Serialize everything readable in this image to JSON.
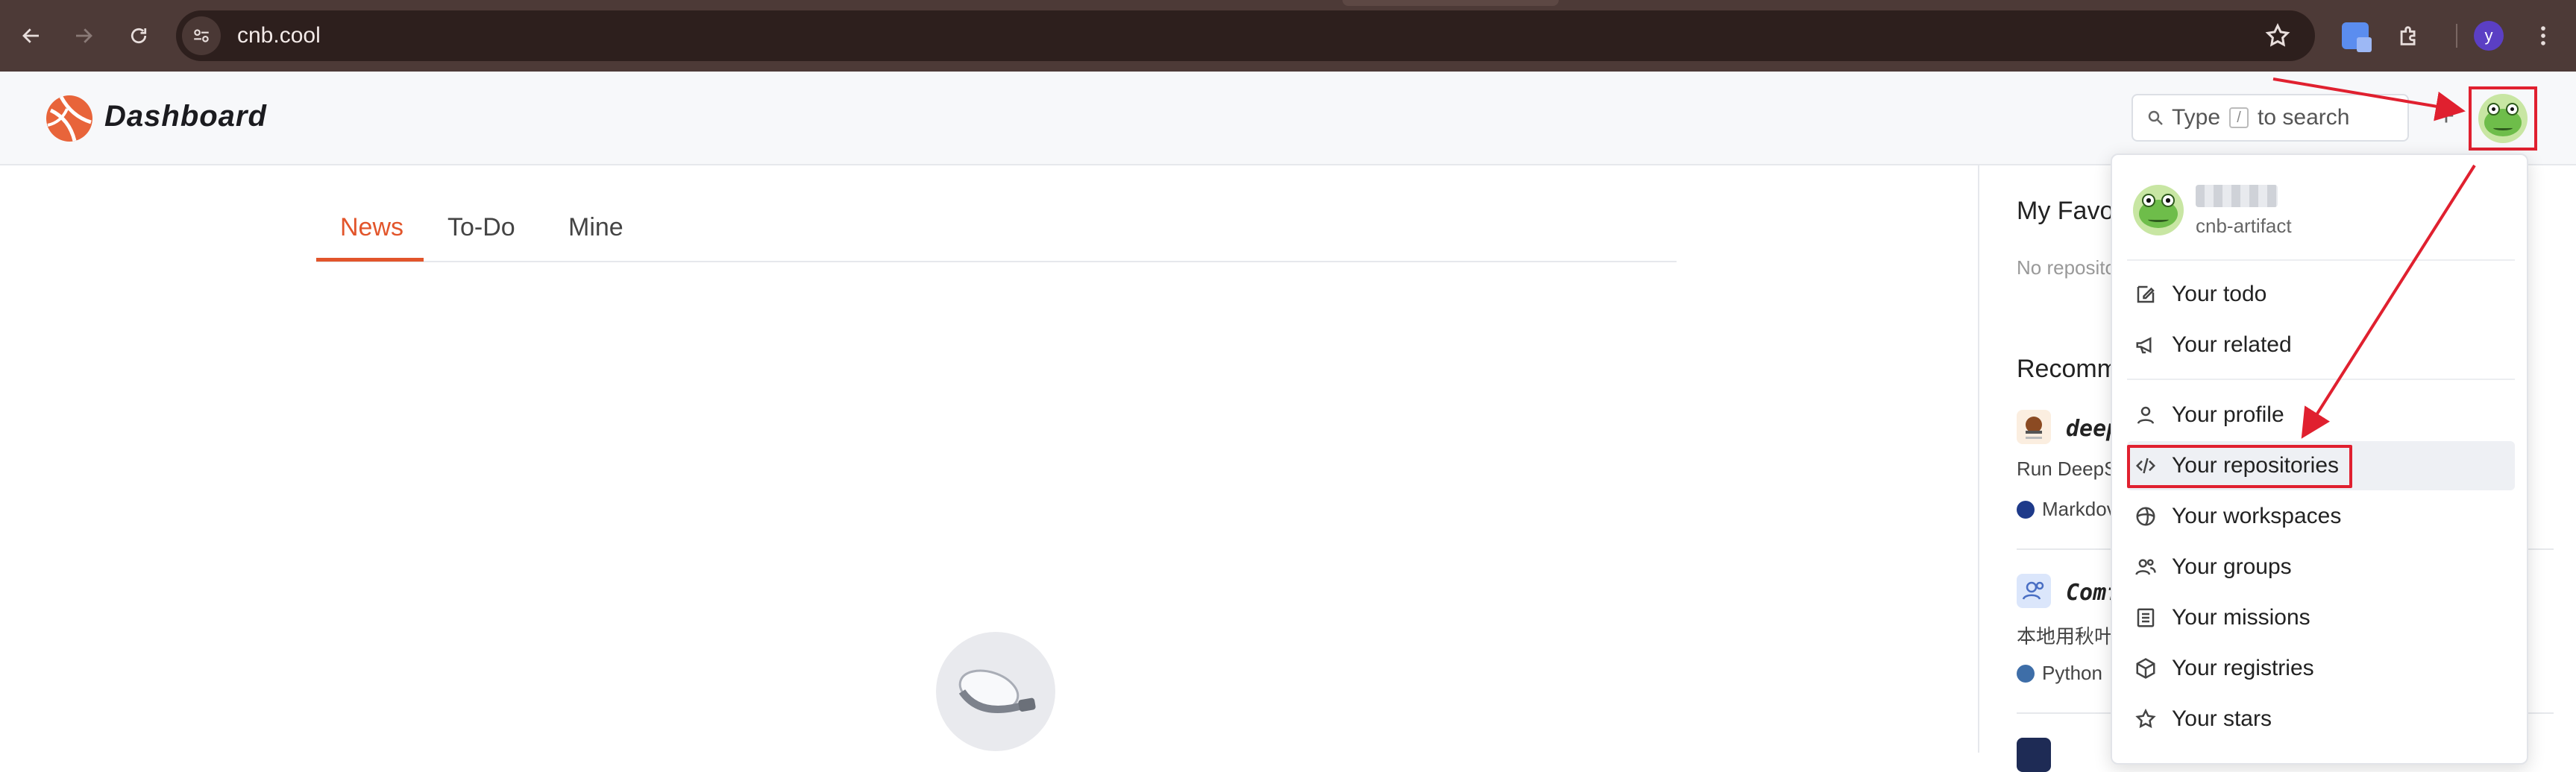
{
  "browser": {
    "url": "cnb.cool",
    "profile_initial": "y",
    "icons": [
      "back-icon",
      "forward-icon",
      "reload-icon",
      "site-info-icon",
      "bookmark-star-icon",
      "translate-icon",
      "extensions-icon",
      "kebab-menu-icon"
    ]
  },
  "header": {
    "brand": "Dashboard",
    "search_prefix": "Type",
    "search_key": "/",
    "search_suffix": "to search",
    "plus": "+"
  },
  "tabs": [
    {
      "label": "News",
      "active": true
    },
    {
      "label": "To-Do",
      "active": false
    },
    {
      "label": "Mine",
      "active": false
    }
  ],
  "right": {
    "favorites_title": "My Favor",
    "favorites_note": "No reposito",
    "recommended_title": "Recomm",
    "repos": [
      {
        "name": "deep",
        "desc": "Run DeepS",
        "lang": "Markdov",
        "lang_color": "#1e3a8a"
      },
      {
        "name": "Comf",
        "desc": "本地用秋叶",
        "lang": "Python",
        "lang_color": "#3e6ea8"
      }
    ]
  },
  "menu": {
    "handle": "cnb-artifact",
    "items": [
      {
        "label": "Your todo",
        "icon": "todo-icon"
      },
      {
        "label": "Your related",
        "icon": "megaphone-icon"
      },
      {
        "label": "Your profile",
        "icon": "person-icon"
      },
      {
        "label": "Your repositories",
        "icon": "code-icon"
      },
      {
        "label": "Your workspaces",
        "icon": "workspace-icon"
      },
      {
        "label": "Your groups",
        "icon": "group-icon"
      },
      {
        "label": "Your missions",
        "icon": "list-icon"
      },
      {
        "label": "Your registries",
        "icon": "cube-icon"
      },
      {
        "label": "Your stars",
        "icon": "star-icon"
      }
    ]
  },
  "colors": {
    "accent": "#e2552b",
    "annotation": "#e0202f",
    "chrome": "#4d3a37"
  }
}
